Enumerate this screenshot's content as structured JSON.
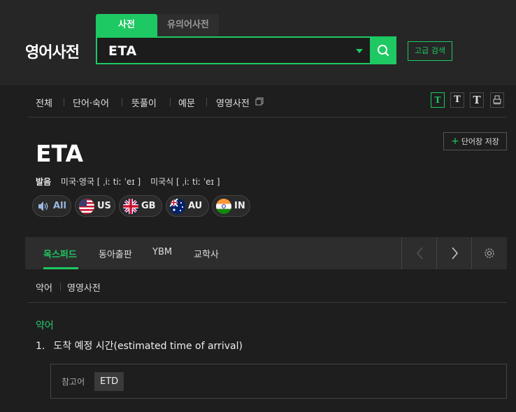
{
  "header": {
    "logo": "영어사전",
    "tabs": [
      "사전",
      "유의어사전"
    ],
    "search_value": "ETA",
    "advanced_search": "고급 검색"
  },
  "subnav": {
    "items": [
      "전체",
      "단어·숙어",
      "뜻풀이",
      "예문",
      "영영사전"
    ],
    "font_buttons": [
      "T",
      "T",
      "T"
    ]
  },
  "entry": {
    "word": "ETA",
    "save_label": "단어장 저장",
    "pron_label": "발음",
    "pron_us_uk": "미국·영국 [ ˌiː tiː ˈeɪ ]",
    "pron_us": "미국식 [ ˌiː tiː ˈeɪ ]",
    "audio": [
      "All",
      "US",
      "GB",
      "AU",
      "IN"
    ]
  },
  "dict_tabs": {
    "tabs": [
      "옥스퍼드",
      "동아출판",
      "YBM",
      "교학사"
    ],
    "active": 0
  },
  "section_links": [
    "약어",
    "영영사전"
  ],
  "definition": {
    "section": "약어",
    "number": "1.",
    "text": "도착 예정 시간(estimated time of arrival)",
    "ref_label": "참고어",
    "ref_word": "ETD"
  },
  "colors": {
    "accent": "#1ec862",
    "background": "#1e1e1e"
  }
}
